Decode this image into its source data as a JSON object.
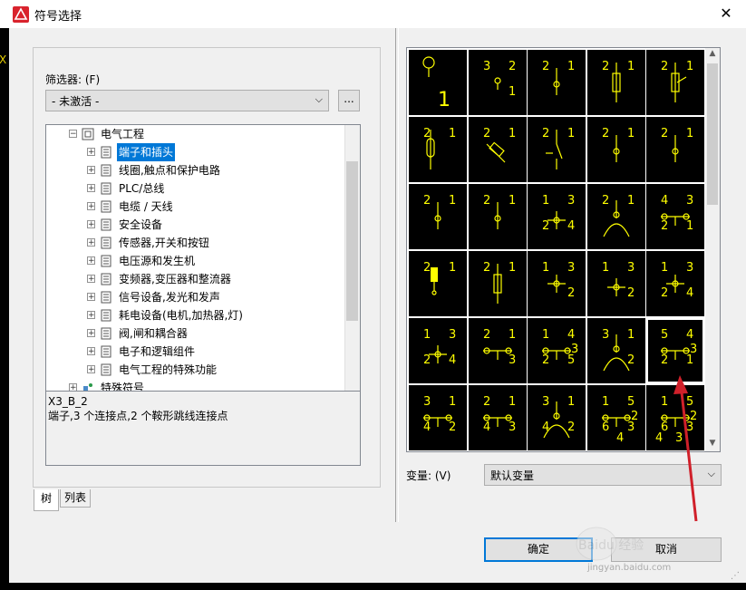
{
  "window": {
    "title": "符号选择",
    "close_glyph": "✕"
  },
  "background": {
    "left_strip_char": "X"
  },
  "filter": {
    "label": "筛选器: (F)",
    "value": "- 未激活 -",
    "browse_label": "..."
  },
  "tree": {
    "root": "电气工程",
    "items": [
      "端子和插头",
      "线圈,触点和保护电路",
      "PLC/总线",
      "电缆 / 天线",
      "安全设备",
      "传感器,开关和按钮",
      "电压源和发生机",
      "变频器,变压器和整流器",
      "信号设备,发光和发声",
      "耗电设备(电机,加热器,灯)",
      "阀,闸和耦合器",
      "电子和逻辑组件",
      "电气工程的特殊功能"
    ],
    "partial_item": "特殊符号",
    "selected_index": 0
  },
  "description": {
    "name": "X3_B_2",
    "text": "端子,3 个连接点,2 个鞍形跳线连接点"
  },
  "tabs": [
    "树",
    "列表"
  ],
  "symbols": {
    "color": "#ffff00",
    "rows": [
      [
        [
          "1"
        ],
        [
          "2",
          "3",
          "1"
        ],
        [
          "1",
          "2"
        ],
        [
          "1",
          "2"
        ],
        [
          "1",
          "2"
        ]
      ],
      [
        [
          "1",
          "2"
        ],
        [
          "1",
          "2"
        ],
        [
          "1",
          "2"
        ],
        [
          "1",
          "2"
        ],
        [
          "1",
          "2"
        ]
      ],
      [
        [
          "1",
          "2"
        ],
        [
          "1",
          "2"
        ],
        [
          "3",
          "1",
          "4",
          "2"
        ],
        [
          "1",
          "2"
        ],
        [
          "3",
          "4",
          "1",
          "2"
        ]
      ],
      [
        [
          "1",
          "2"
        ],
        [
          "1",
          "2"
        ],
        [
          "3",
          "1",
          "2"
        ],
        [
          "3",
          "1",
          "2"
        ],
        [
          "3",
          "1",
          "4",
          "2"
        ]
      ],
      [
        [
          "3",
          "1",
          "4",
          "2"
        ],
        [
          "1",
          "2",
          "3"
        ],
        [
          "4",
          "1",
          "5",
          "2",
          "3"
        ],
        [
          "1",
          "3",
          "2"
        ],
        [
          "4",
          "5",
          "1",
          "2",
          "3"
        ]
      ],
      [
        [
          "1",
          "3",
          "2",
          "4"
        ],
        [
          "1",
          "2",
          "3",
          "4"
        ],
        [
          "1",
          "3",
          "2",
          "4"
        ],
        [
          "5",
          "1",
          "3",
          "6",
          "2",
          "4"
        ],
        [
          "5",
          "1",
          "3",
          "6",
          "2",
          "3",
          "4"
        ]
      ]
    ],
    "selected_cell": "4-4"
  },
  "variant": {
    "label": "变量: (V)",
    "value": "默认变量"
  },
  "buttons": {
    "ok": "确定",
    "cancel": "取消"
  },
  "watermark": {
    "text": "Baidu 经验",
    "url": "jingyan.baidu.com"
  }
}
